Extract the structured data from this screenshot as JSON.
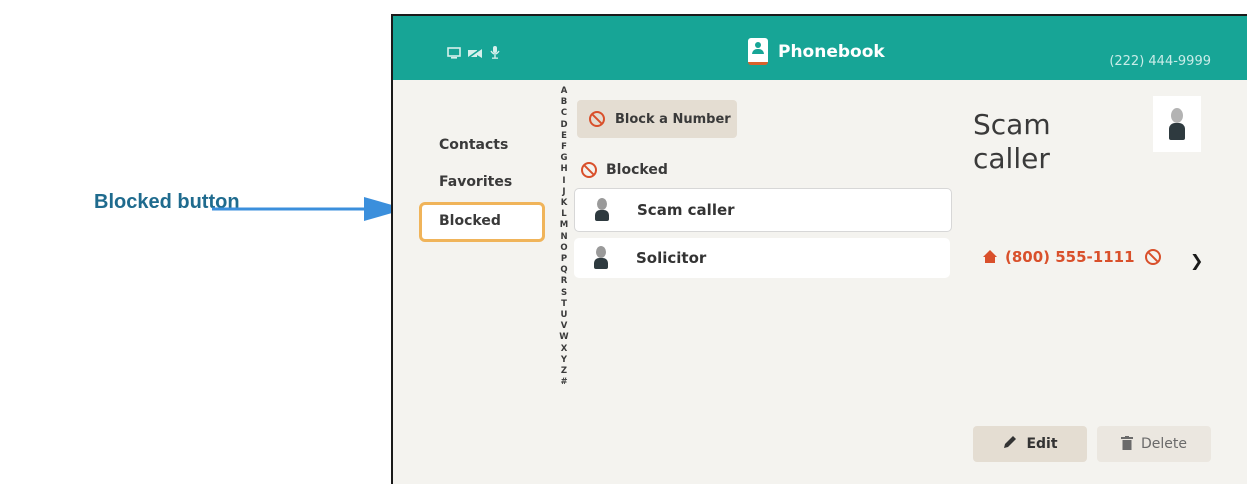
{
  "callout": {
    "label": "Blocked button"
  },
  "header": {
    "title": "Phonebook",
    "my_number": "(222) 444-9999"
  },
  "nav": {
    "items": [
      {
        "label": "Contacts"
      },
      {
        "label": "Favorites"
      },
      {
        "label": "Blocked",
        "selected": true
      }
    ]
  },
  "alphabet": [
    "A",
    "B",
    "C",
    "D",
    "E",
    "F",
    "G",
    "H",
    "I",
    "J",
    "K",
    "L",
    "M",
    "N",
    "O",
    "P",
    "Q",
    "R",
    "S",
    "T",
    "U",
    "V",
    "W",
    "X",
    "Y",
    "Z",
    "#"
  ],
  "list": {
    "block_button": "Block a Number",
    "section_title": "Blocked",
    "rows": [
      {
        "name": "Scam caller",
        "selected": true
      },
      {
        "name": "Solicitor"
      }
    ]
  },
  "detail": {
    "name": "Scam caller",
    "phone": "(800) 555-1111",
    "edit_label": "Edit",
    "delete_label": "Delete"
  },
  "colors": {
    "header": "#17a596",
    "accent": "#d9502b",
    "selection_border": "#f0b45a",
    "callout": "#1f6b8e"
  }
}
